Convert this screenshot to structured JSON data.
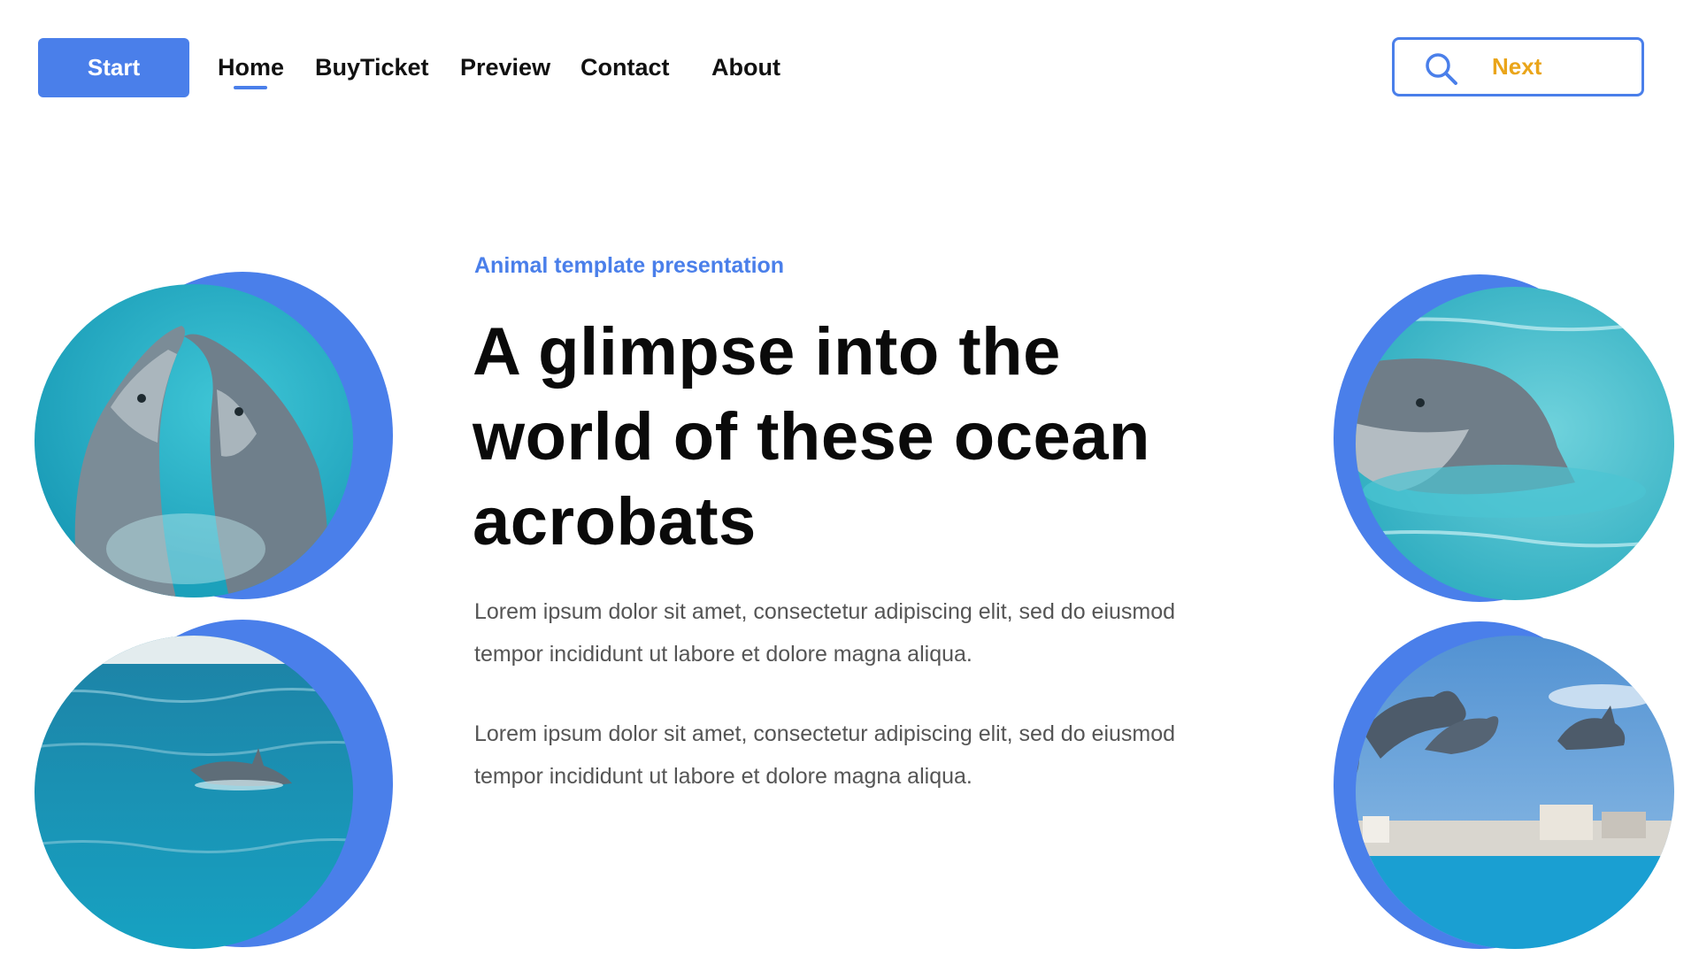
{
  "header": {
    "start_label": "Start",
    "nav": [
      {
        "label": "Home",
        "active": true
      },
      {
        "label": "BuyTicket",
        "active": false
      },
      {
        "label": "Preview",
        "active": false
      },
      {
        "label": "Contact",
        "active": false
      },
      {
        "label": "About",
        "active": false
      }
    ],
    "next_label": "Next",
    "search_icon": "search-icon"
  },
  "hero": {
    "eyebrow": "Animal template presentation",
    "headline_lines": [
      "A glimpse into the",
      "world of these ocean",
      "acrobats"
    ],
    "paragraphs": [
      "Lorem ipsum dolor sit amet, consectetur adipiscing elit, sed do eiusmod tempor incididunt ut labore et dolore magna aliqua.",
      "Lorem ipsum dolor sit amet, consectetur adipiscing elit, sed do eiusmod tempor incididunt ut labore et dolore magna aliqua."
    ]
  },
  "photos": [
    {
      "subject": "two dolphins in turquoise water"
    },
    {
      "subject": "dolphin swimming in open sea"
    },
    {
      "subject": "dolphin head above rippling water"
    },
    {
      "subject": "dolphins jumping over a pool"
    }
  ],
  "colors": {
    "accent": "#4a7fea",
    "next_text": "#eaa51a",
    "heading": "#0a0a0a",
    "body_text": "#555555"
  }
}
